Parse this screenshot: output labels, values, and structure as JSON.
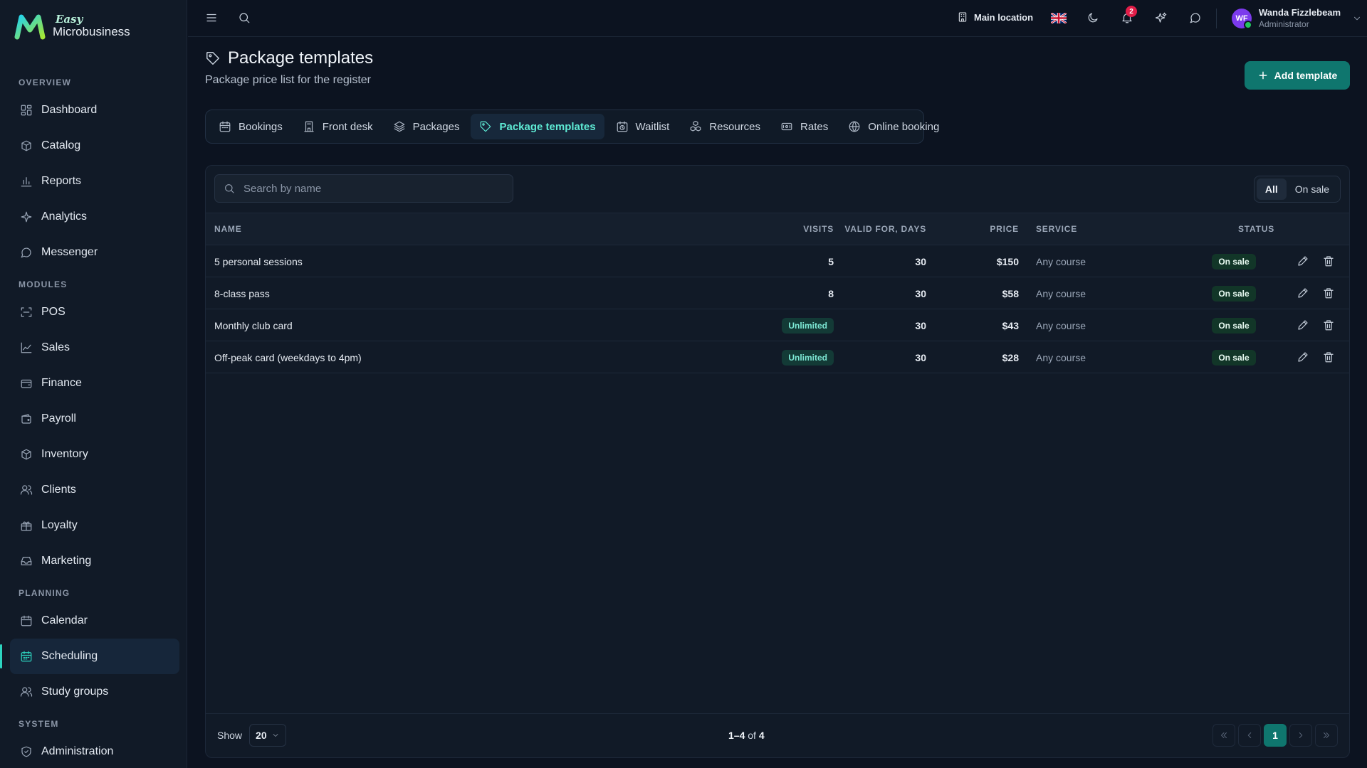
{
  "brand": {
    "easy": "Easy",
    "name": "Microbusiness"
  },
  "sidebar": {
    "sections": [
      {
        "title": "OVERVIEW",
        "items": [
          "Dashboard",
          "Catalog",
          "Reports",
          "Analytics",
          "Messenger"
        ]
      },
      {
        "title": "MODULES",
        "items": [
          "POS",
          "Sales",
          "Finance",
          "Payroll",
          "Inventory",
          "Clients",
          "Loyalty",
          "Marketing"
        ]
      },
      {
        "title": "PLANNING",
        "items": [
          "Calendar",
          "Scheduling",
          "Study groups"
        ]
      },
      {
        "title": "SYSTEM",
        "items": [
          "Administration"
        ]
      }
    ],
    "active": "Scheduling"
  },
  "topbar": {
    "location": "Main location",
    "notifications_count": "2",
    "user": {
      "initials": "WF",
      "name": "Wanda Fizzlebeam",
      "role": "Administrator"
    }
  },
  "page": {
    "title": "Package templates",
    "subtitle": "Package price list for the register",
    "add_button": "Add template"
  },
  "tabs": [
    {
      "label": "Bookings",
      "icon": "calendar-icon"
    },
    {
      "label": "Front desk",
      "icon": "desk-icon"
    },
    {
      "label": "Packages",
      "icon": "layers-icon"
    },
    {
      "label": "Package templates",
      "icon": "tag-icon",
      "active": true
    },
    {
      "label": "Waitlist",
      "icon": "clock-calendar-icon"
    },
    {
      "label": "Resources",
      "icon": "boxes-icon"
    },
    {
      "label": "Rates",
      "icon": "ticket-icon"
    },
    {
      "label": "Online booking",
      "icon": "globe-icon"
    }
  ],
  "search": {
    "placeholder": "Search by name"
  },
  "filter": {
    "all": "All",
    "on_sale": "On sale",
    "selected": "All"
  },
  "table": {
    "headers": {
      "name": "NAME",
      "visits": "VISITS",
      "valid_for": "VALID FOR, DAYS",
      "price": "PRICE",
      "service": "SERVICE",
      "status": "STATUS"
    },
    "rows": [
      {
        "name": "5 personal sessions",
        "visits": "5",
        "valid_for": "30",
        "price": "$150",
        "service": "Any course",
        "status": "On sale"
      },
      {
        "name": "8-class pass",
        "visits": "8",
        "valid_for": "30",
        "price": "$58",
        "service": "Any course",
        "status": "On sale"
      },
      {
        "name": "Monthly club card",
        "visits": "Unlimited",
        "valid_for": "30",
        "price": "$43",
        "service": "Any course",
        "status": "On sale"
      },
      {
        "name": "Off-peak card (weekdays to 4pm)",
        "visits": "Unlimited",
        "valid_for": "30",
        "price": "$28",
        "service": "Any course",
        "status": "On sale"
      }
    ]
  },
  "footer": {
    "show_label": "Show",
    "page_size": "20",
    "range": "1–4",
    "of": "of",
    "total": "4",
    "current_page": "1"
  },
  "colors": {
    "accent": "#0f766e",
    "accent_text": "#5eead4",
    "background": "#0c1320",
    "sidebar": "#111a27"
  }
}
